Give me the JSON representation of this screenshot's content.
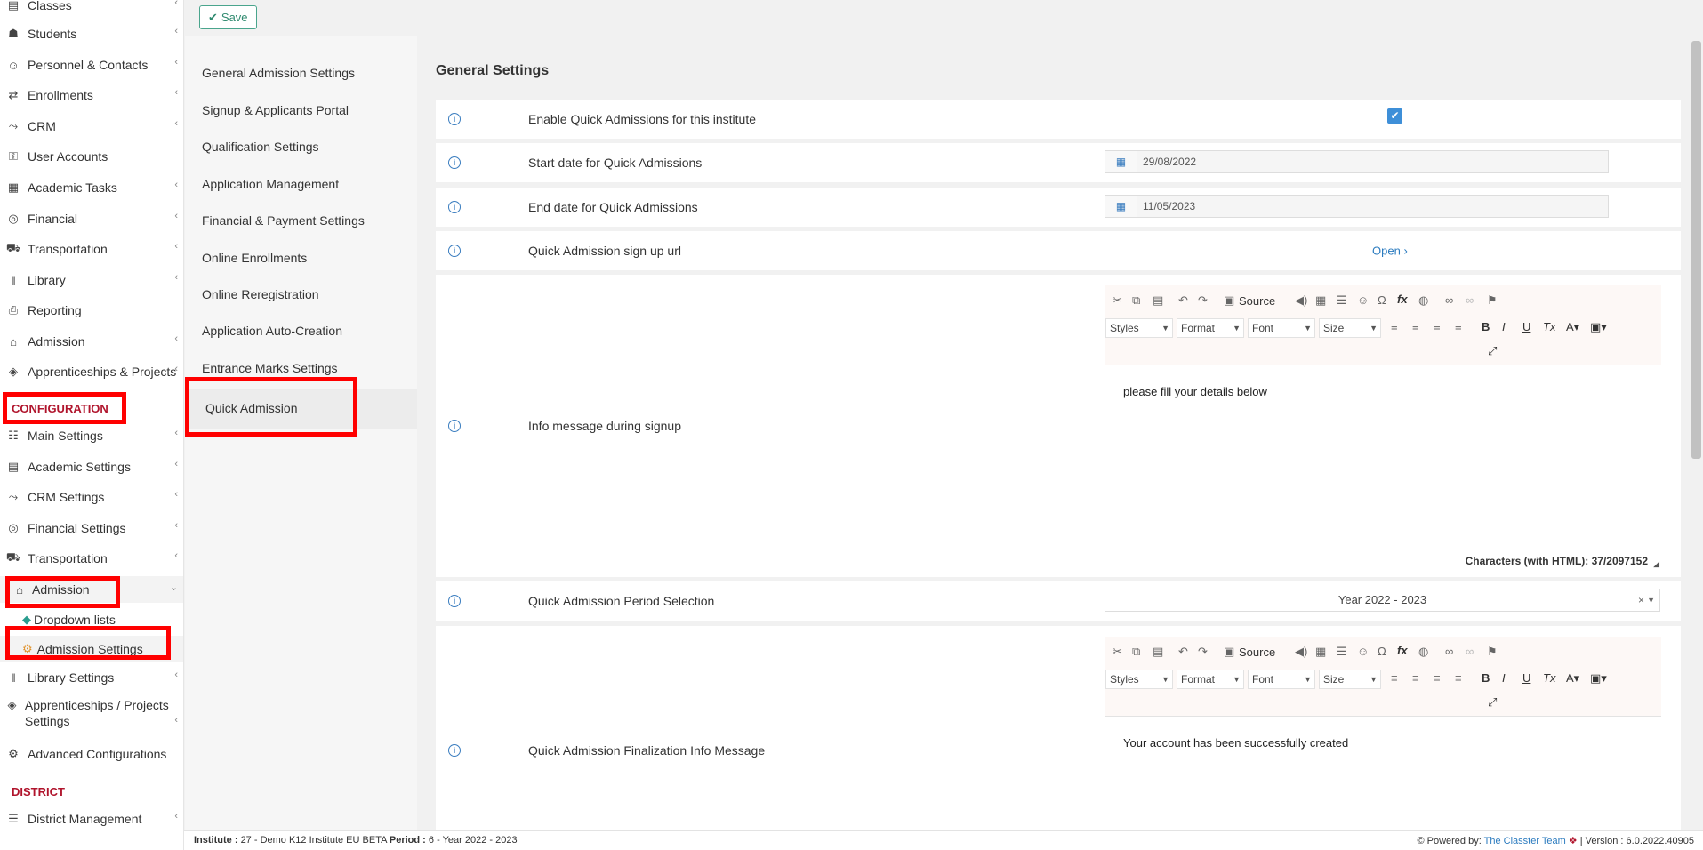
{
  "nav": {
    "items": [
      {
        "label": "Classes",
        "icon": "classes-icon"
      },
      {
        "label": "Students",
        "icon": "students-icon"
      },
      {
        "label": "Personnel & Contacts",
        "icon": "personnel-icon"
      },
      {
        "label": "Enrollments",
        "icon": "enrollments-icon"
      },
      {
        "label": "CRM",
        "icon": "crm-icon"
      },
      {
        "label": "User Accounts",
        "icon": "key-icon"
      },
      {
        "label": "Academic Tasks",
        "icon": "tasks-icon"
      },
      {
        "label": "Financial",
        "icon": "coins-icon"
      },
      {
        "label": "Transportation",
        "icon": "bus-icon"
      },
      {
        "label": "Library",
        "icon": "library-icon"
      },
      {
        "label": "Reporting",
        "icon": "printer-icon"
      },
      {
        "label": "Admission",
        "icon": "institution-icon"
      },
      {
        "label": "Apprenticeships & Projects",
        "icon": "cube-icon"
      }
    ],
    "config_heading": "CONFIGURATION",
    "config_items": [
      {
        "label": "Main Settings",
        "icon": "sliders-icon"
      },
      {
        "label": "Academic Settings",
        "icon": "classes-icon"
      },
      {
        "label": "CRM Settings",
        "icon": "crm-icon"
      },
      {
        "label": "Financial Settings",
        "icon": "coins-icon"
      },
      {
        "label": "Transportation",
        "icon": "bus-icon"
      }
    ],
    "admission_expanded": "Admission",
    "admission_sub": [
      "Dropdown lists",
      "Admission Settings"
    ],
    "config_items_after": [
      {
        "label": "Library Settings",
        "icon": "library-icon"
      },
      {
        "label": "Apprenticeships / Projects Settings",
        "icon": "cube-icon"
      },
      {
        "label": "Advanced Configurations",
        "icon": "gears-icon"
      }
    ],
    "district_heading": "DISTRICT",
    "district_items": [
      {
        "label": "District Management",
        "icon": "list-icon"
      }
    ]
  },
  "toolbar": {
    "save_label": "Save"
  },
  "settings_menu": {
    "items": [
      "General Admission Settings",
      "Signup & Applicants Portal",
      "Qualification Settings",
      "Application Management",
      "Financial & Payment Settings",
      "Online Enrollments",
      "Online Reregistration",
      "Application Auto-Creation",
      "Entrance Marks Settings"
    ],
    "active": "Quick Admission"
  },
  "main": {
    "title": "General Settings",
    "enable_label": "Enable Quick Admissions for this institute",
    "start_label": "Start date for Quick Admissions",
    "start_value": "29/08/2022",
    "end_label": "End date for Quick Admissions",
    "end_value": "11/05/2023",
    "signup_url_label": "Quick Admission sign up url",
    "open_label": "Open",
    "info_msg_label": "Info message during signup",
    "info_msg_text": "please fill your details below",
    "char_count": "Characters (with HTML): 37/2097152",
    "period_label": "Quick Admission Period Selection",
    "period_value": "Year 2022 - 2023",
    "final_msg_label": "Quick Admission Finalization Info Message",
    "final_msg_text": "Your account has been successfully created"
  },
  "editor": {
    "source_label": "Source",
    "styles": "Styles",
    "format": "Format",
    "font": "Font",
    "size": "Size"
  },
  "footer": {
    "institute_label": "Institute :",
    "institute_value": "27 - Demo K12 Institute EU BETA",
    "period_label": "Period :",
    "period_value": "6 - Year 2022 - 2023",
    "powered_label": "Powered by:",
    "powered_link": "The Classter Team",
    "version_label": "| Version : 6.0.2022.40905"
  }
}
